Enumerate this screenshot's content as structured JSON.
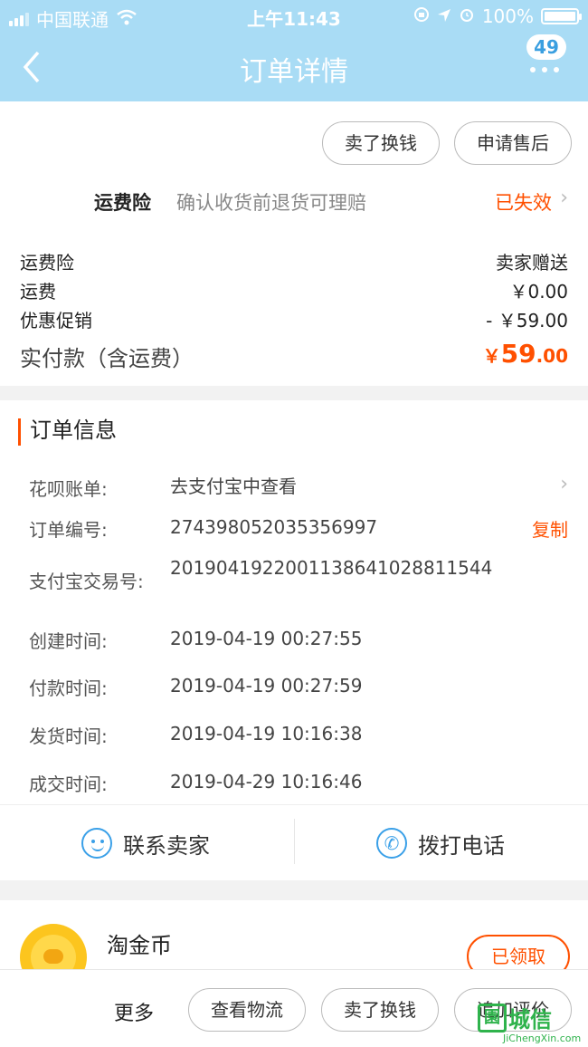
{
  "status_bar": {
    "carrier": "中国联通",
    "time": "上午11:43",
    "battery": "100%",
    "wifi_icon": "wifi-icon",
    "lock_icon": "rotation-lock-icon",
    "location_icon": "location-arrow-icon",
    "alarm_icon": "alarm-icon"
  },
  "nav": {
    "title": "订单详情",
    "badge": "49",
    "back_icon": "chevron-left-icon",
    "more_icon": "more-dots-icon"
  },
  "actions": {
    "sell_exchange": "卖了换钱",
    "after_sale": "申请售后"
  },
  "insurance": {
    "name": "运费险",
    "desc": "确认收货前退货可理赔",
    "status": "已失效"
  },
  "fees": [
    {
      "label": "运费险",
      "value": "卖家赠送"
    },
    {
      "label": "运费",
      "value": "￥0.00"
    },
    {
      "label": "优惠促销",
      "value": "- ￥59.00"
    }
  ],
  "paid": {
    "label": "实付款（含运费）",
    "symbol": "￥",
    "integer": "59",
    "decimal": ".00"
  },
  "order_info": {
    "title": "订单信息",
    "rows": [
      {
        "label": "花呗账单:",
        "value": "去支付宝中查看"
      },
      {
        "label": "订单编号:",
        "value": "274398052035356997",
        "action": "复制"
      },
      {
        "label": "支付宝交易号:",
        "value": "2019041922001138641028811544"
      },
      {
        "label": "创建时间:",
        "value": "2019-04-19 00:27:55"
      },
      {
        "label": "付款时间:",
        "value": "2019-04-19 00:27:59"
      },
      {
        "label": "发货时间:",
        "value": "2019-04-19 10:16:38"
      },
      {
        "label": "成交时间:",
        "value": "2019-04-29 10:16:46"
      }
    ]
  },
  "contact": {
    "seller": "联系卖家",
    "call": "拨打电话"
  },
  "coin": {
    "title": "淘金币",
    "button": "已领取"
  },
  "bottom_bar": {
    "more": "更多",
    "logistics": "查看物流",
    "sell_exchange": "卖了换钱",
    "review": "追加评价"
  },
  "watermark": {
    "cn": "城信",
    "en": "JiChengXin.com",
    "mark": "園"
  },
  "colors": {
    "header_bg": "#a9dcf5",
    "accent": "#ff5000",
    "icon_blue": "#3aa0e8"
  }
}
